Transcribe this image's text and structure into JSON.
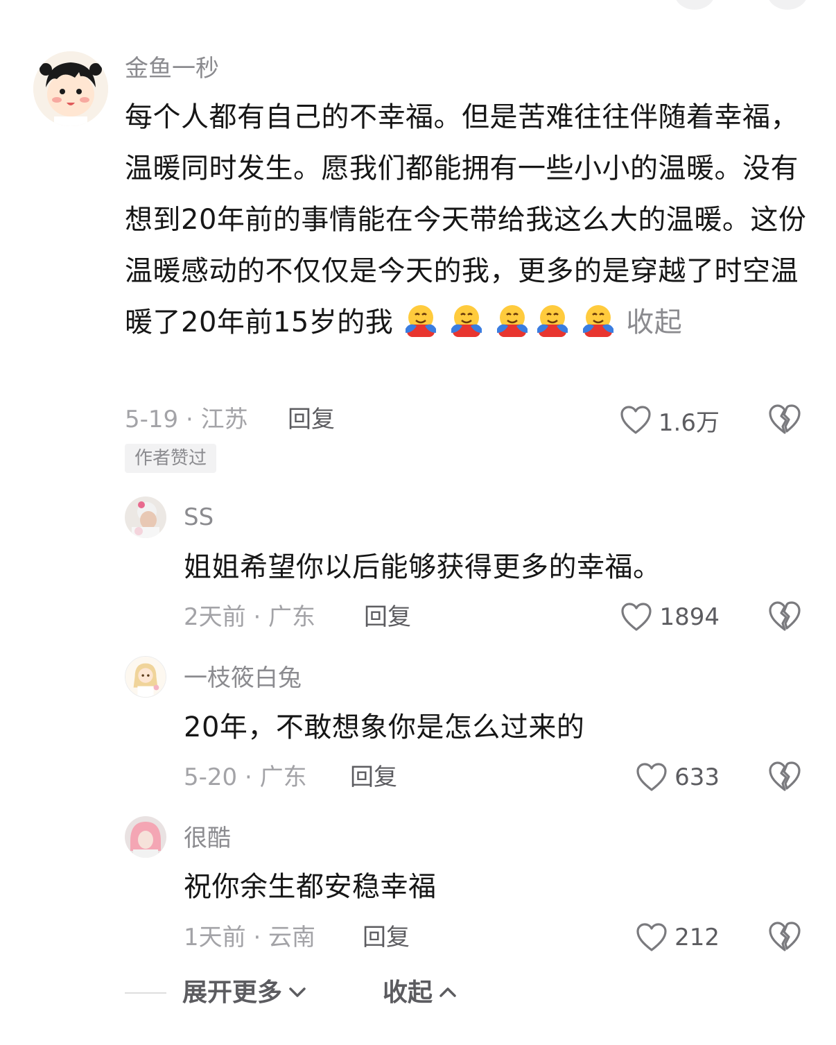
{
  "main_comment": {
    "username": "金鱼一秒",
    "text": "每个人都有自己的不幸福。但是苦难往往伴随着幸福，温暖同时发生。愿我们都能拥有一些小小的温暖。没有想到20年前的事情能在今天带给我这么大的温暖。这份温暖感动的不仅仅是今天的我，更多的是穿越了时空温暖了20年前15岁的我",
    "emojis": [
      "hugging-face-emoji",
      "hugging-face-emoji",
      "hugging-face-emoji",
      "hugging-face-emoji",
      "hugging-face-emoji"
    ],
    "collapse_label": "收起",
    "meta": "5-19 · 江苏",
    "reply_label": "回复",
    "likes": "1.6万",
    "author_badge": "作者赞过"
  },
  "replies": [
    {
      "username": "SS",
      "text": "姐姐希望你以后能够获得更多的幸福。",
      "meta": "2天前 · 广东",
      "reply_label": "回复",
      "likes": "1894"
    },
    {
      "username": "一枝筱白兔",
      "text": "20年，不敢想象你是怎么过来的",
      "meta": "5-20 · 广东",
      "reply_label": "回复",
      "likes": "633"
    },
    {
      "username": "很酷",
      "text": "祝你余生都安稳幸福",
      "meta": "1天前 · 云南",
      "reply_label": "回复",
      "likes": "212"
    }
  ],
  "footer": {
    "expand_more": "展开更多",
    "collapse": "收起"
  },
  "icons": {
    "like": "heart-outline-icon",
    "dislike": "broken-heart-icon",
    "expand": "chevron-down-icon",
    "collapse": "chevron-up-icon"
  }
}
